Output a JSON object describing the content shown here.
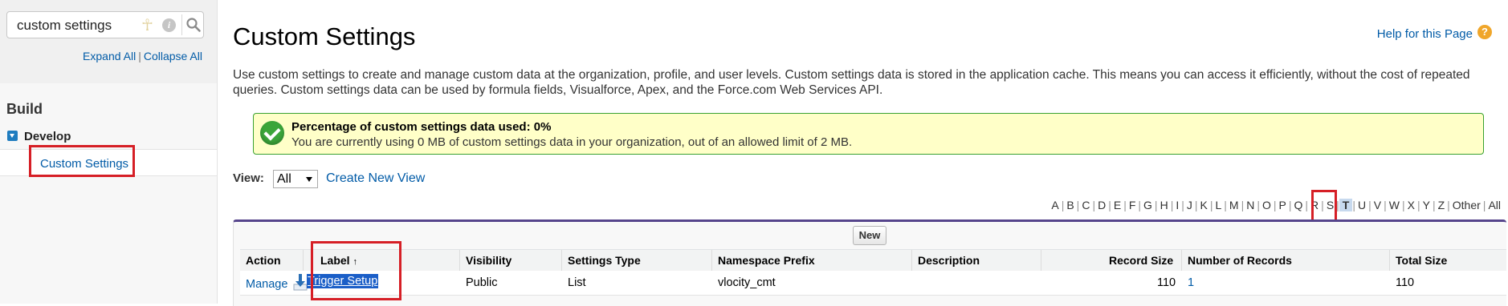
{
  "sidebar": {
    "search_value": "custom settings",
    "expand_all": "Expand All",
    "separator": "|",
    "collapse_all": "Collapse All",
    "build_heading": "Build",
    "develop_label": "Develop",
    "custom_settings_item": "Custom Settings"
  },
  "header": {
    "title": "Custom Settings",
    "help_link": "Help for this Page",
    "help_icon_glyph": "?",
    "description": "Use custom settings to create and manage custom data at the organization, profile, and user levels. Custom settings data is stored in the application cache. This means you can access it efficiently, without the cost of repeated queries. Custom settings data can be used by formula fields, Visualforce, Apex, and the Force.com Web Services API."
  },
  "message": {
    "title": "Percentage of custom settings data used: 0%",
    "text": "You are currently using 0 MB of custom settings data in your organization, out of an allowed limit of 2 MB."
  },
  "view": {
    "label": "View:",
    "selected": "All",
    "create_link": "Create New View"
  },
  "alphabet": [
    "A",
    "B",
    "C",
    "D",
    "E",
    "F",
    "G",
    "H",
    "I",
    "J",
    "K",
    "L",
    "M",
    "N",
    "O",
    "P",
    "Q",
    "R",
    "S",
    "T",
    "U",
    "V",
    "W",
    "X",
    "Y",
    "Z",
    "Other",
    "All"
  ],
  "alphabet_active": "T",
  "table": {
    "new_button": "New",
    "headers": {
      "action": "Action",
      "label": "Label",
      "sort_indicator": "↑",
      "visibility": "Visibility",
      "settings_type": "Settings Type",
      "namespace": "Namespace Prefix",
      "description": "Description",
      "record_size": "Record Size",
      "num_records": "Number of Records",
      "total_size": "Total Size"
    },
    "row": {
      "action": "Manage",
      "label": "Trigger Setup",
      "visibility": "Public",
      "settings_type": "List",
      "namespace": "vlocity_cmt",
      "description": "",
      "record_size": "110",
      "num_records": "1",
      "total_size": "110"
    }
  },
  "colors": {
    "link": "#015ba7",
    "highlight_red": "#d61f26",
    "success_green": "#3ba53a",
    "message_bg": "#ffffc8",
    "table_accent": "#56458c",
    "selection_blue": "#1a5ec7"
  }
}
